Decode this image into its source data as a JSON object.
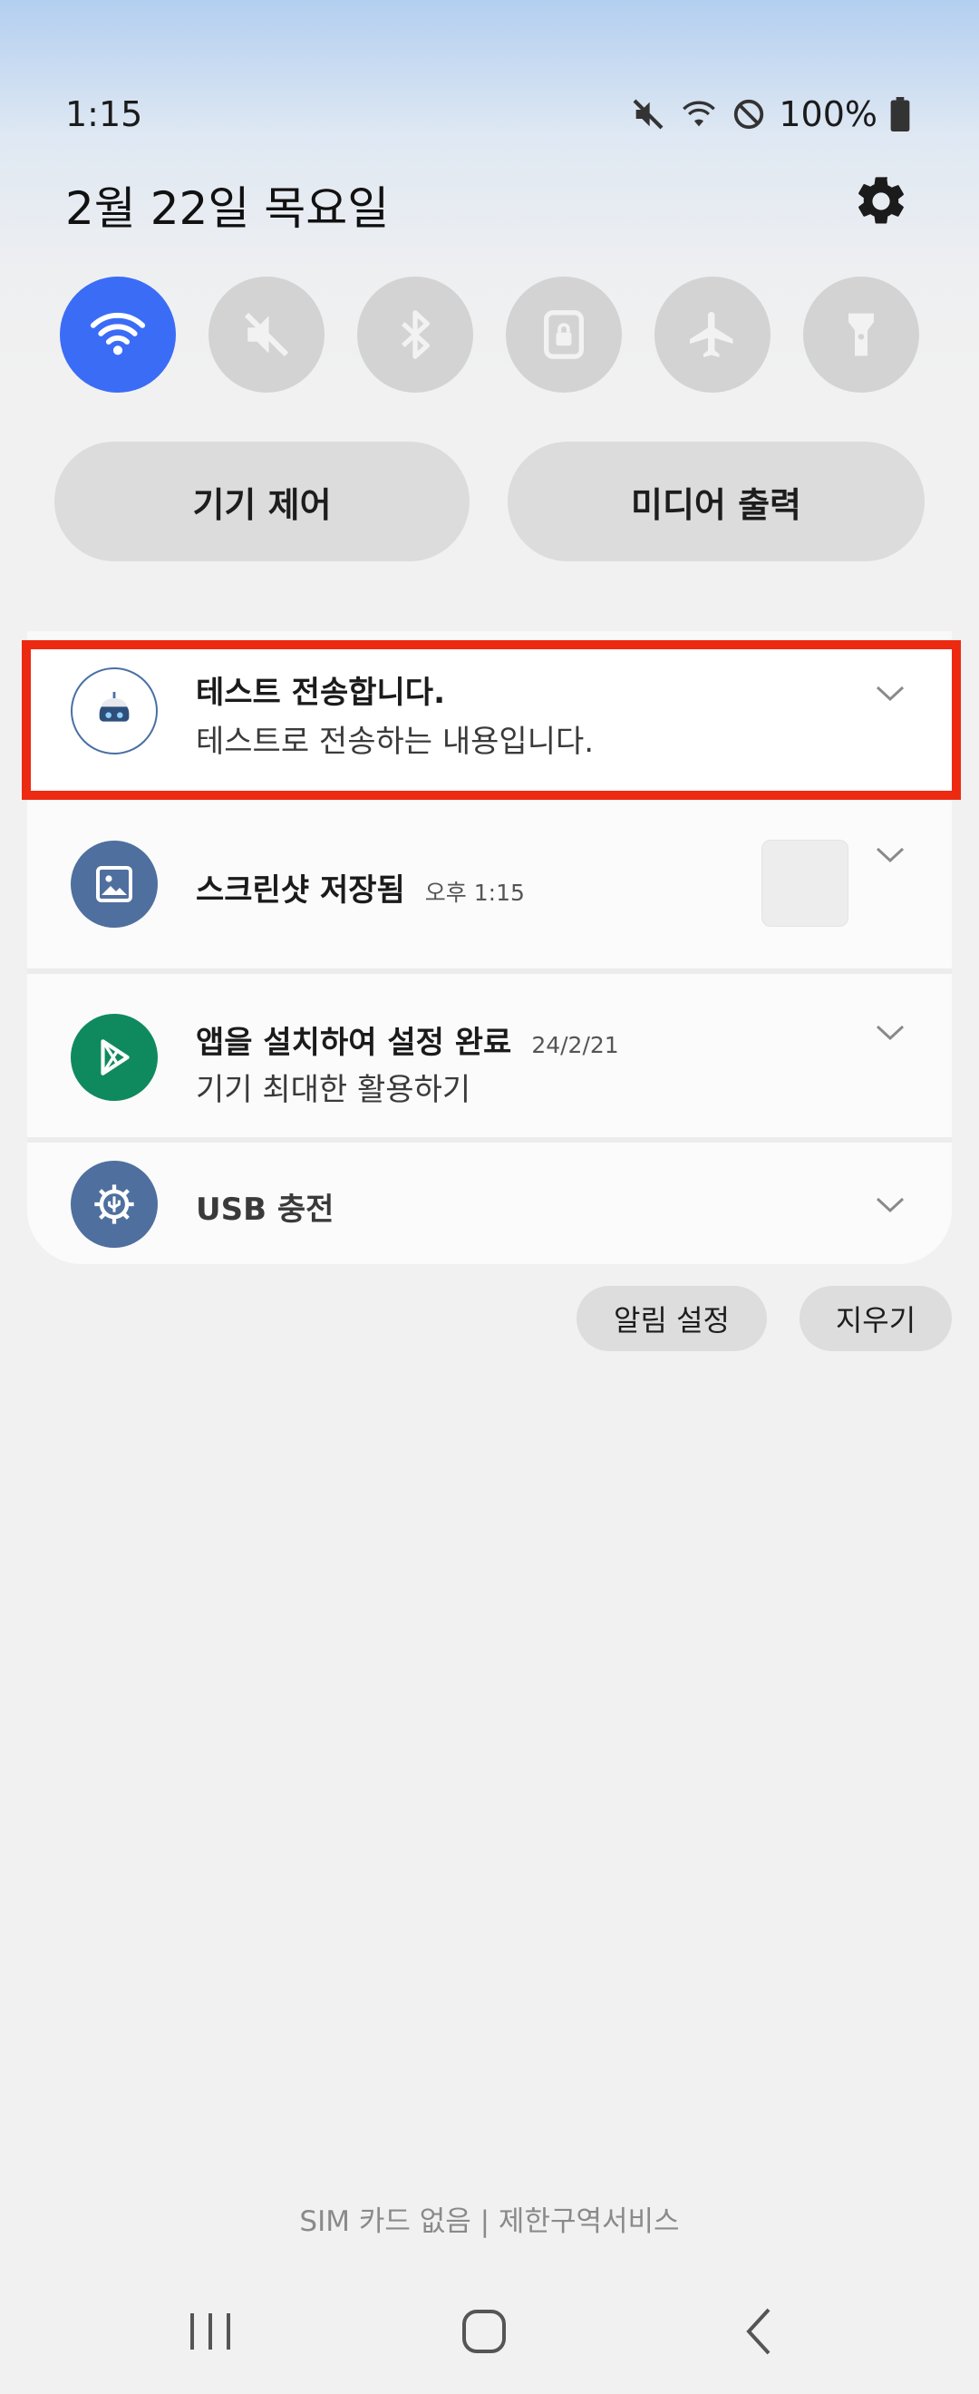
{
  "status_bar": {
    "time": "1:15",
    "battery": "100%",
    "icons": [
      "mute-icon",
      "wifi-icon",
      "do-not-disturb-icon",
      "battery-icon"
    ]
  },
  "header": {
    "date": "2월 22일 목요일",
    "settings_icon": "gear-icon"
  },
  "quick_settings": [
    {
      "name": "wifi",
      "icon": "wifi-icon",
      "active": true
    },
    {
      "name": "sound",
      "icon": "mute-icon",
      "active": false
    },
    {
      "name": "bluetooth",
      "icon": "bluetooth-icon",
      "active": false
    },
    {
      "name": "rotation-lock",
      "icon": "portrait-lock-icon",
      "active": false
    },
    {
      "name": "airplane-mode",
      "icon": "airplane-icon",
      "active": false
    },
    {
      "name": "flashlight",
      "icon": "flashlight-icon",
      "active": false
    }
  ],
  "pills": {
    "device_control": "기기 제어",
    "media_output": "미디어 출력"
  },
  "notifications": [
    {
      "title": "테스트 전송합니다.",
      "meta": "",
      "body": "테스트로 전송하는 내용입니다.",
      "icon": "robot-app-icon"
    },
    {
      "title": "스크린샷 저장됨",
      "meta": "오후 1:15",
      "body": "",
      "icon": "image-icon"
    },
    {
      "title": "앱을 설치하여 설정 완료",
      "meta": "24/2/21",
      "body": "기기 최대한 활용하기",
      "icon": "play-store-icon"
    },
    {
      "title": "USB 충전",
      "meta": "",
      "body": "",
      "icon": "usb-settings-icon"
    }
  ],
  "actions": {
    "notification_settings": "알림 설정",
    "clear": "지우기"
  },
  "carrier_text": "SIM 카드 없음 | 제한구역서비스",
  "colors": {
    "accent": "#3b6cf6",
    "highlight": "#ec2a12",
    "toggle_off": "#d3d3d3"
  }
}
